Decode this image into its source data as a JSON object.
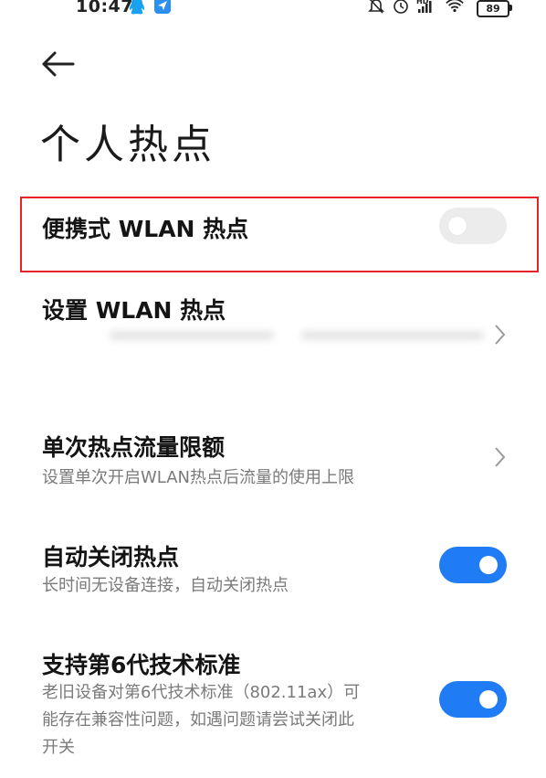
{
  "status_bar": {
    "time": "10:47",
    "network_badge": "HD",
    "battery_level": "89"
  },
  "header": {
    "title": "个人热点"
  },
  "settings": {
    "portable_hotspot": {
      "title": "便携式 WLAN 热点",
      "enabled": false
    },
    "configure_hotspot": {
      "title": "设置 WLAN 热点"
    },
    "data_limit": {
      "title": "单次热点流量限额",
      "subtitle": "设置单次开启WLAN热点后流量的使用上限"
    },
    "auto_off": {
      "title": "自动关闭热点",
      "subtitle": "长时间无设备连接，自动关闭热点",
      "enabled": true
    },
    "wifi6": {
      "title": "支持第6代技术标准",
      "subtitle_lines": [
        "老旧设备对第6代技术标准（802.11ax）可",
        "能存在兼容性问题，如遇问题请尝试关闭此",
        "开关"
      ],
      "enabled": true
    }
  },
  "colors": {
    "accent": "#1f7cf4",
    "highlight_border": "#e5242a",
    "toggle_off": "#ececec",
    "subtitle_text": "#7a7a7a"
  },
  "icons": [
    "qq-icon",
    "send-icon",
    "mute-bell-icon",
    "alarm-icon",
    "signal-icon",
    "wifi-icon",
    "battery-icon",
    "back-arrow-icon",
    "chevron-right-icon"
  ]
}
